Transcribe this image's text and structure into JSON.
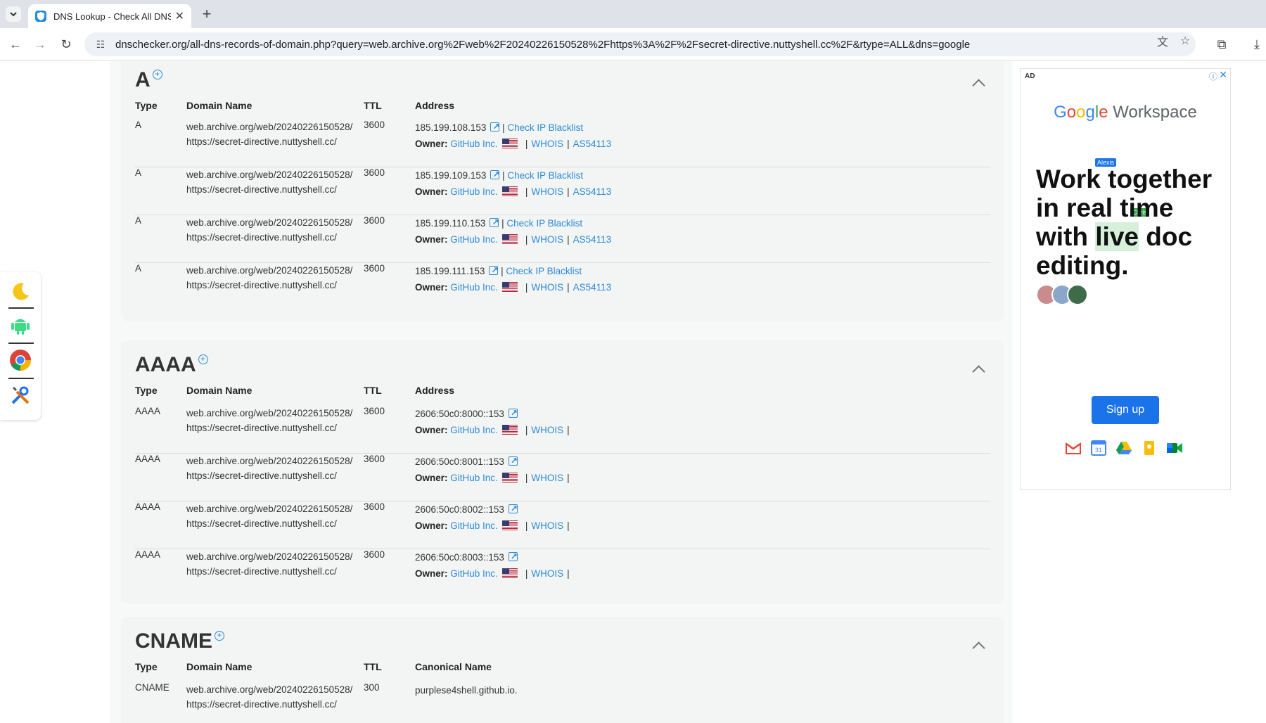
{
  "browser": {
    "tab_title": "DNS Lookup - Check All DNS",
    "url": "dnschecker.org/all-dns-records-of-domain.php?query=web.archive.org%2Fweb%2F20240226150528%2Fhttps%3A%2F%2Fsecret-directive.nuttyshell.cc%2F&rtype=ALL&dns=google"
  },
  "icons": {
    "tab_menu": "chevron-down-icon",
    "favicon": "dnschecker-shield-icon",
    "tab_close": "close-icon",
    "new_tab": "plus-icon",
    "back": "arrow-left-icon",
    "forward": "arrow-right-icon",
    "reload": "reload-icon",
    "site_info": "tune-icon",
    "translate": "translate-icon",
    "bookmark": "star-icon",
    "extensions": "puzzle-icon",
    "download": "download-icon"
  },
  "headers": {
    "type": "Type",
    "domain": "Domain Name",
    "ttl": "TTL",
    "address": "Address",
    "canonical": "Canonical Name"
  },
  "sections": [
    {
      "title": "A",
      "records": [
        {
          "type": "A",
          "domain1": "web.archive.org/web/20240226150528/",
          "domain2": "https://secret-directive.nuttyshell.cc/",
          "ttl": "3600",
          "address": "185.199.108.153",
          "blacklist": "Check IP Blacklist",
          "owner_label": "Owner:",
          "owner": "GitHub Inc.",
          "whois": "WHOIS",
          "asn": "AS54113"
        },
        {
          "type": "A",
          "domain1": "web.archive.org/web/20240226150528/",
          "domain2": "https://secret-directive.nuttyshell.cc/",
          "ttl": "3600",
          "address": "185.199.109.153",
          "blacklist": "Check IP Blacklist",
          "owner_label": "Owner:",
          "owner": "GitHub Inc.",
          "whois": "WHOIS",
          "asn": "AS54113"
        },
        {
          "type": "A",
          "domain1": "web.archive.org/web/20240226150528/",
          "domain2": "https://secret-directive.nuttyshell.cc/",
          "ttl": "3600",
          "address": "185.199.110.153",
          "blacklist": "Check IP Blacklist",
          "owner_label": "Owner:",
          "owner": "GitHub Inc.",
          "whois": "WHOIS",
          "asn": "AS54113"
        },
        {
          "type": "A",
          "domain1": "web.archive.org/web/20240226150528/",
          "domain2": "https://secret-directive.nuttyshell.cc/",
          "ttl": "3600",
          "address": "185.199.111.153",
          "blacklist": "Check IP Blacklist",
          "owner_label": "Owner:",
          "owner": "GitHub Inc.",
          "whois": "WHOIS",
          "asn": "AS54113"
        }
      ]
    },
    {
      "title": "AAAA",
      "records": [
        {
          "type": "AAAA",
          "domain1": "web.archive.org/web/20240226150528/",
          "domain2": "https://secret-directive.nuttyshell.cc/",
          "ttl": "3600",
          "address": "2606:50c0:8000::153",
          "owner_label": "Owner:",
          "owner": "GitHub Inc.",
          "whois": "WHOIS"
        },
        {
          "type": "AAAA",
          "domain1": "web.archive.org/web/20240226150528/",
          "domain2": "https://secret-directive.nuttyshell.cc/",
          "ttl": "3600",
          "address": "2606:50c0:8001::153",
          "owner_label": "Owner:",
          "owner": "GitHub Inc.",
          "whois": "WHOIS"
        },
        {
          "type": "AAAA",
          "domain1": "web.archive.org/web/20240226150528/",
          "domain2": "https://secret-directive.nuttyshell.cc/",
          "ttl": "3600",
          "address": "2606:50c0:8002::153",
          "owner_label": "Owner:",
          "owner": "GitHub Inc.",
          "whois": "WHOIS"
        },
        {
          "type": "AAAA",
          "domain1": "web.archive.org/web/20240226150528/",
          "domain2": "https://secret-directive.nuttyshell.cc/",
          "ttl": "3600",
          "address": "2606:50c0:8003::153",
          "owner_label": "Owner:",
          "owner": "GitHub Inc.",
          "whois": "WHOIS"
        }
      ]
    },
    {
      "title": "CNAME",
      "records": [
        {
          "type": "CNAME",
          "domain1": "web.archive.org/web/20240226150528/",
          "domain2": "https://secret-directive.nuttyshell.cc/",
          "ttl": "300",
          "canonical": "purplese4shell.github.io."
        }
      ]
    }
  ],
  "floating_bar": [
    "moon-icon",
    "android-icon",
    "chrome-icon",
    "tools-icon"
  ],
  "ad": {
    "label": "AD",
    "logo_google": [
      "G",
      "o",
      "o",
      "g",
      "l",
      "e"
    ],
    "logo_workspace": "Workspace",
    "headline_1": "Work",
    "headline_2": " together in real time with ",
    "headline_hl": "live",
    "headline_3": " doc editing.",
    "cursor_1": "Alexis",
    "cursor_2": "Chris",
    "button": "Sign up",
    "apps": [
      "gmail-icon",
      "calendar-icon",
      "drive-icon",
      "keep-icon",
      "meet-icon"
    ]
  }
}
